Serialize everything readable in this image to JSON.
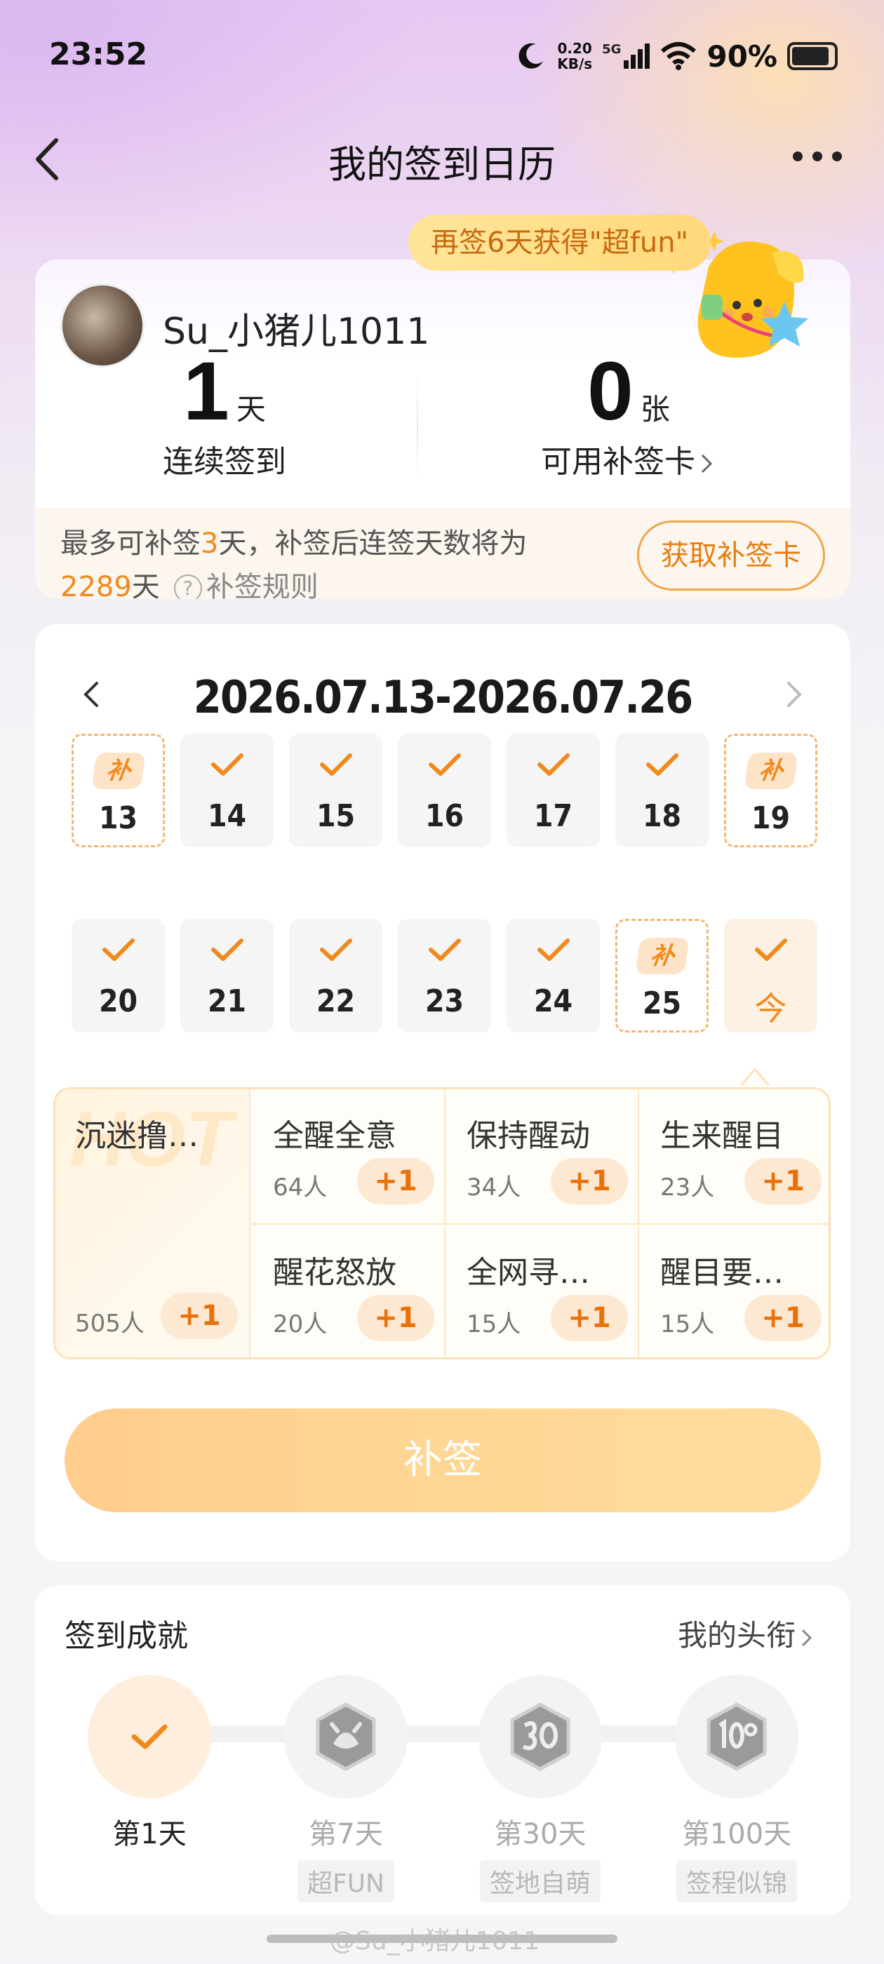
{
  "status_bar": {
    "time": "23:52",
    "net_speed_top": "0.20",
    "net_speed_bottom": "KB/s",
    "network": "5G",
    "battery": "90%",
    "moon_icon": "moon-icon",
    "signal_icon": "signal-icon",
    "wifi_icon": "wifi-icon",
    "battery_icon": "battery-icon",
    "battery_level": 0.9
  },
  "nav": {
    "title": "我的签到日历",
    "back_icon": "chevron-left-icon",
    "more_icon": "more-icon"
  },
  "tooltip": "再签6天获得\"超fun\"",
  "profile": {
    "username": "Su_小猪儿1011",
    "streak_num": "1",
    "streak_unit": "天",
    "streak_label": "连续签到",
    "cards_num": "0",
    "cards_unit": "张",
    "cards_label": "可用补签卡"
  },
  "makeup": {
    "line1_a": "最多可补签",
    "line1_num": "3",
    "line1_b": "天，补签后连签天数将为",
    "line2_num": "2289",
    "line2_unit": "天",
    "rules": "补签规则",
    "get_card": "获取补签卡",
    "help_icon": "question-circle-icon"
  },
  "calendar": {
    "range": "2026.07.13-2026.07.26",
    "week1": [
      {
        "day": "13",
        "state": "makeup"
      },
      {
        "day": "14",
        "state": "checked"
      },
      {
        "day": "15",
        "state": "checked"
      },
      {
        "day": "16",
        "state": "checked"
      },
      {
        "day": "17",
        "state": "checked"
      },
      {
        "day": "18",
        "state": "checked"
      },
      {
        "day": "19",
        "state": "makeup"
      }
    ],
    "week2": [
      {
        "day": "20",
        "state": "checked"
      },
      {
        "day": "21",
        "state": "checked"
      },
      {
        "day": "22",
        "state": "checked"
      },
      {
        "day": "23",
        "state": "checked"
      },
      {
        "day": "24",
        "state": "checked"
      },
      {
        "day": "25",
        "state": "makeup"
      },
      {
        "day": "今",
        "state": "today"
      }
    ],
    "makeup_badge": "补"
  },
  "reasons": {
    "hot_watermark": "HOT",
    "hot": {
      "name": "沉迷撸…",
      "count": "505人",
      "action": "+1"
    },
    "items": [
      {
        "name": "全醒全意",
        "count": "64人",
        "action": "+1"
      },
      {
        "name": "保持醒动",
        "count": "34人",
        "action": "+1"
      },
      {
        "name": "生来醒目",
        "count": "23人",
        "action": "+1"
      },
      {
        "name": "醒花怒放",
        "count": "20人",
        "action": "+1"
      },
      {
        "name": "全网寻…",
        "count": "15人",
        "action": "+1"
      },
      {
        "name": "醒目要…",
        "count": "15人",
        "action": "+1"
      }
    ]
  },
  "makeup_button": "补签",
  "achievements": {
    "title": "签到成就",
    "link": "我的头衔",
    "items": [
      {
        "label": "第1天",
        "tag": "",
        "done": true
      },
      {
        "label": "第7天",
        "tag": "超FUN",
        "done": false
      },
      {
        "label": "第30天",
        "tag": "签地自萌",
        "done": false
      },
      {
        "label": "第100天",
        "tag": "签程似锦",
        "done": false
      }
    ]
  },
  "watermark": "@Su_小猪儿1011",
  "colors": {
    "accent": "#f08a1c",
    "makeup_button": "#ffd08e",
    "card_bg": "#ffffff"
  }
}
